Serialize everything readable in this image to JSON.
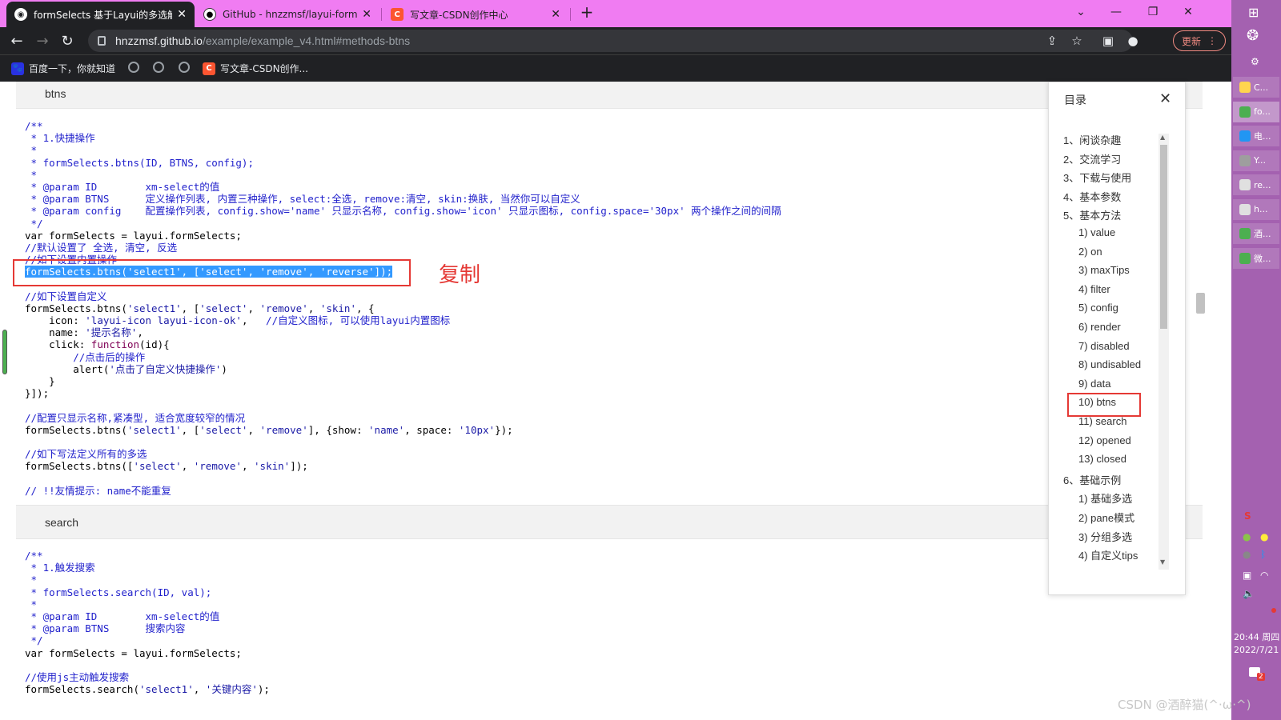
{
  "browser": {
    "tabs": [
      {
        "title": "formSelects 基于Layui的多选解",
        "active": true
      },
      {
        "title": "GitHub - hnzzmsf/layui-formS",
        "active": false
      },
      {
        "title": "写文章-CSDN创作中心",
        "active": false
      }
    ],
    "new_tab": "+",
    "url_host": "hnzzmsf.github.io",
    "url_path": "/example/example_v4.html#methods-btns",
    "update_label": "更新",
    "bookmarks": [
      {
        "label": "百度一下，你就知道"
      },
      {
        "label": "写文章-CSDN创作..."
      }
    ]
  },
  "page": {
    "section_btns": "btns",
    "section_search": "search",
    "copy_label": "复制",
    "btns_code": [
      "/**",
      " * 1.快捷操作",
      " *",
      " * formSelects.btns(ID, BTNS, config);",
      " *",
      " * @param ID        xm-select的值",
      " * @param BTNS      定义操作列表, 内置三种操作, select:全选, remove:清空, skin:换肤, 当然你可以自定义",
      " * @param config    配置操作列表, config.show='name' 只显示名称, config.show='icon' 只显示图标, config.space='30px' 两个操作之间的间隔",
      " */",
      "var formSelects = layui.formSelects;",
      "//默认设置了 全选, 清空, 反选",
      "//如下设置内置操作",
      "formSelects.btns('select1', ['select', 'remove', 'reverse']);",
      "",
      "//如下设置自定义",
      "formSelects.btns('select1', ['select', 'remove', 'skin', {",
      "    icon: 'layui-icon layui-icon-ok',   //自定义图标, 可以使用layui内置图标",
      "    name: '提示名称',",
      "    click: function(id){",
      "        //点击后的操作",
      "        alert('点击了自定义快捷操作')",
      "    }",
      "}]);",
      "",
      "//配置只显示名称,紧凑型, 适合宽度较窄的情况",
      "formSelects.btns('select1', ['select', 'remove'], {show: 'name', space: '10px'});",
      "",
      "//如下写法定义所有的多选",
      "formSelects.btns(['select', 'remove', 'skin']);",
      "",
      "// !!友情提示: name不能重复"
    ],
    "search_code": [
      "/**",
      " * 1.触发搜索",
      " *",
      " * formSelects.search(ID, val);",
      " *",
      " * @param ID        xm-select的值",
      " * @param BTNS      搜索内容",
      " */",
      "var formSelects = layui.formSelects;",
      "",
      "//使用js主动触发搜索",
      "formSelects.search('select1', '关键内容');"
    ]
  },
  "toc": {
    "title": "目录",
    "items": [
      "1、闲谈杂趣",
      "2、交流学习",
      "3、下载与使用",
      "4、基本参数",
      "5、基本方法",
      "1) value",
      "2) on",
      "3) maxTips",
      "4) filter",
      "5) config",
      "6) render",
      "7) disabled",
      "8) undisabled",
      "9) data",
      "10) btns",
      "11) search",
      "12) opened",
      "13) closed",
      "6、基础示例",
      "1) 基础多选",
      "2) pane模式",
      "3) 分组多选",
      "4) 自定义tips"
    ],
    "highlighted": "10) btns"
  },
  "taskbar": {
    "apps": [
      "C...",
      "fo...",
      "电...",
      "Y...",
      "re...",
      "h...",
      "酒...",
      "微..."
    ],
    "time": "20:44 周四",
    "date": "2022/7/21",
    "notification_count": "2"
  },
  "watermark": "CSDN @酒醉猫(^·ω·^)"
}
